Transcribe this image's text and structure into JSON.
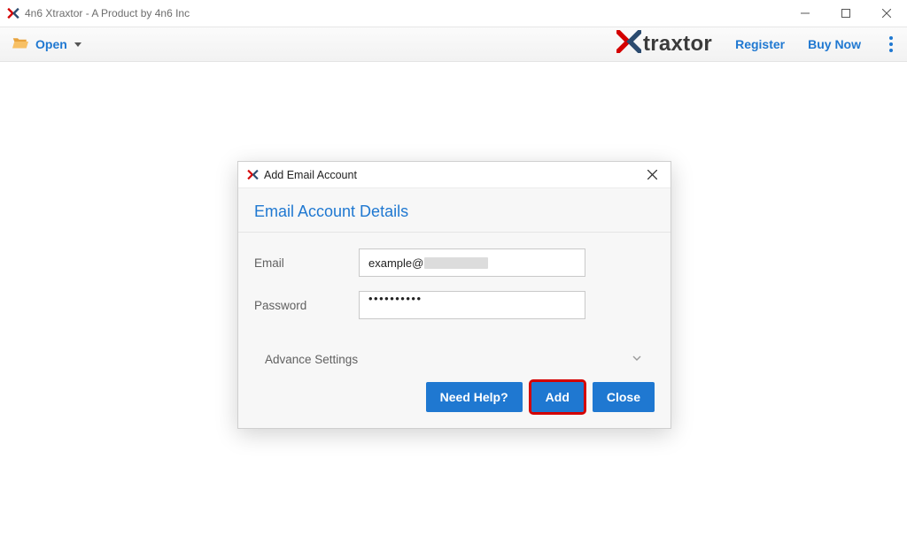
{
  "window": {
    "title": "4n6 Xtraxtor - A Product by 4n6 Inc"
  },
  "toolbar": {
    "open_label": "Open",
    "register_label": "Register",
    "buy_label": "Buy Now",
    "brand_text": "traxtor"
  },
  "dialog": {
    "title": "Add Email Account",
    "section_title": "Email Account Details",
    "email_label": "Email",
    "email_value": "example@",
    "password_label": "Password",
    "password_value": "••••••••••",
    "advance_label": "Advance Settings",
    "help_btn": "Need Help?",
    "add_btn": "Add",
    "close_btn": "Close"
  }
}
